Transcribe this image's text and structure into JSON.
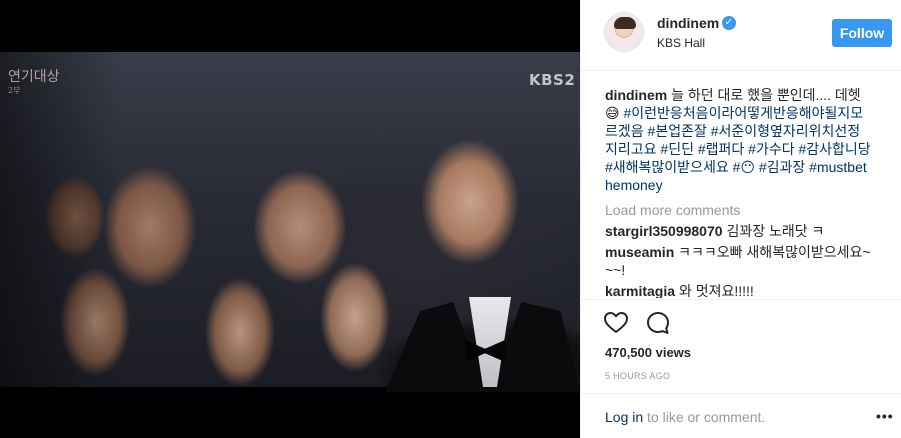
{
  "video": {
    "award_logo": "연기대상",
    "award_logo_sub": "2부",
    "channel_logo": "KBS2"
  },
  "header": {
    "username": "dindinem",
    "location": "KBS Hall",
    "follow_label": "Follow"
  },
  "caption": {
    "username": "dindinem",
    "text": "늘 하던 대로 했을 뿐인데.... 데헷😅",
    "tags": "#이런반응처음이라어떻게반응해야될지모르겠음 #본업존잘 #서준이형옆자리위치선정지리고요 #딘딘 #랩퍼다 #가수다 #감사합니당 #새해복많이받으세요 #😶 #김과장 #mustbethemoney"
  },
  "load_more": "Load more comments",
  "comments": [
    {
      "username": "stargirl350998070",
      "text": "김꽈장 노래닷 ㅋ"
    },
    {
      "username": "museamin",
      "text": "ㅋㅋㅋ오빠 새해복많이받으세요~~~!"
    },
    {
      "username": "karmitagia",
      "text": "와 멋져요!!!!!"
    }
  ],
  "views": "470,500 views",
  "time": "5 HOURS AGO",
  "login": {
    "link": "Log in",
    "rest": " to like or comment."
  },
  "more_label": "•••",
  "colors": {
    "accent": "#3897f0",
    "link": "#003569"
  }
}
